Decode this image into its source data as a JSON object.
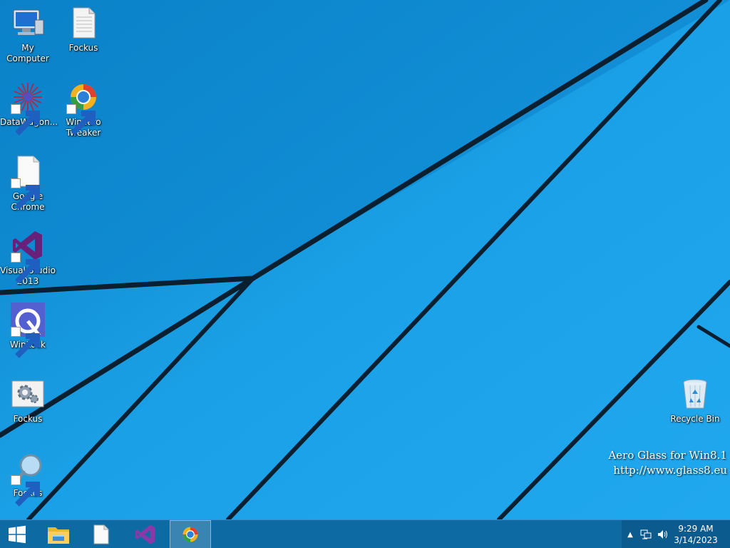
{
  "desktop": {
    "icons": [
      {
        "label": "My Computer",
        "icon": "computer-icon",
        "shortcut": false
      },
      {
        "label": "Fockus",
        "icon": "document-icon",
        "shortcut": false
      },
      {
        "label": "DataWagon...",
        "icon": "datawagon-icon",
        "shortcut": true
      },
      {
        "label": "Winaero Tweaker",
        "icon": "winaero-icon",
        "shortcut": true
      },
      {
        "label": "Google Chrome",
        "icon": "blank-file-icon",
        "shortcut": true
      },
      {
        "label": "Visual Studio 2013",
        "icon": "visual-studio-icon",
        "shortcut": true
      },
      {
        "label": "WinLock",
        "icon": "winlock-icon",
        "shortcut": true
      },
      {
        "label": "Fockus",
        "icon": "gear-settings-icon",
        "shortcut": false
      },
      {
        "label": "Fockus",
        "icon": "magnifier-icon",
        "shortcut": true
      },
      {
        "label": "Recycle Bin",
        "icon": "recycle-bin-icon",
        "shortcut": false
      }
    ],
    "watermark": {
      "line1": "Aero Glass for Win8.1",
      "line2": "http://www.glass8.eu"
    }
  },
  "taskbar": {
    "buttons": [
      "start-icon",
      "file-explorer-icon",
      "blank-file-icon",
      "visual-studio-icon",
      "winaero-icon"
    ],
    "tray": {
      "chevron": "▲",
      "icons": [
        "network-icon",
        "speaker-icon"
      ],
      "time": "9:29 AM",
      "date": "3/14/2023"
    }
  },
  "colors": {
    "wallpaper": "#1398e0",
    "taskbar": "#0e6aa3",
    "lines": "#0a2030"
  }
}
